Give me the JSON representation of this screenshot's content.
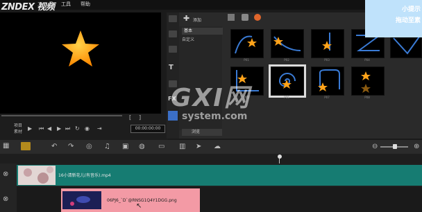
{
  "menu": {
    "brand": "ZNDEX 视频",
    "item_a": "工",
    "item_b": "具",
    "work": "工具",
    "help": "帮助"
  },
  "preview": {
    "project_label": "项目",
    "clip_label": "素材",
    "timecode": "00:00:00:00"
  },
  "library": {
    "add_label": "添加",
    "categories": [
      "基本",
      "自定义"
    ],
    "browse_label": "浏览",
    "thumb_labels": [
      "P01",
      "P02",
      "P03",
      "P04",
      "P05",
      "P06",
      "P07",
      "P08",
      "P09"
    ]
  },
  "tip": {
    "title": "小提示",
    "body": "拖动至素"
  },
  "timeline": {
    "video_clip_name": "16小清新花儿(有音乐).mp4",
    "overlay_clip_name": "06PJ6_`D`@RNSG1Q4Y1DGG.png"
  },
  "watermark": {
    "logo": "GXI网",
    "site": "system.com"
  },
  "colors": {
    "video_clip": "#167c72",
    "overlay_clip": "#f39aa5",
    "tip_panel": "#bfe2fb",
    "star": "#ffa31a"
  }
}
